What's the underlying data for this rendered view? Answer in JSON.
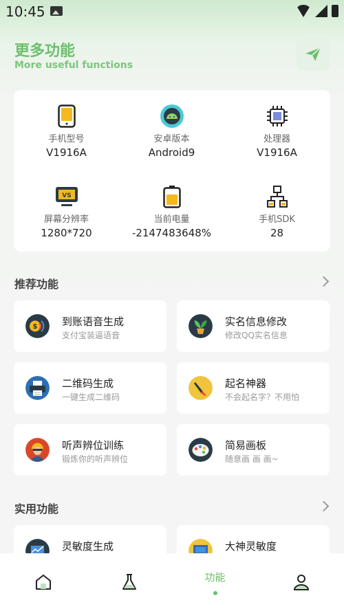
{
  "status_bar": {
    "time": "10:45"
  },
  "header": {
    "title": "更多功能",
    "subtitle": "More useful functions"
  },
  "device_info": [
    {
      "label": "手机型号",
      "value": "V1916A",
      "icon": "phone-icon"
    },
    {
      "label": "安卓版本",
      "value": "Android9",
      "icon": "android-icon"
    },
    {
      "label": "处理器",
      "value": "V1916A",
      "icon": "cpu-icon"
    },
    {
      "label": "屏幕分辨率",
      "value": "1280*720",
      "icon": "monitor-icon"
    },
    {
      "label": "当前电量",
      "value": "-2147483648%",
      "icon": "battery-icon"
    },
    {
      "label": "手机SDK",
      "value": "28",
      "icon": "network-icon"
    }
  ],
  "recommended": {
    "title": "推荐功能",
    "items": [
      {
        "title": "到账语音生成",
        "subtitle": "支付宝装逼语音"
      },
      {
        "title": "实名信息修改",
        "subtitle": "修改QQ实名信息"
      },
      {
        "title": "二维码生成",
        "subtitle": "一键生成二维码"
      },
      {
        "title": "起名神器",
        "subtitle": "不会起名字？不用怕"
      },
      {
        "title": "听声辨位训练",
        "subtitle": "锻炼你的听声辨位"
      },
      {
        "title": "简易画板",
        "subtitle": "随意画 画 画~"
      }
    ]
  },
  "practical": {
    "title": "实用功能",
    "items": [
      {
        "title": "灵敏度生成"
      },
      {
        "title": "大神灵敏度"
      }
    ]
  },
  "bottom_nav": {
    "active_label": "功能"
  },
  "colors": {
    "accent": "#6dbf6d",
    "background": "#f4f5f4",
    "card": "#ffffff"
  }
}
